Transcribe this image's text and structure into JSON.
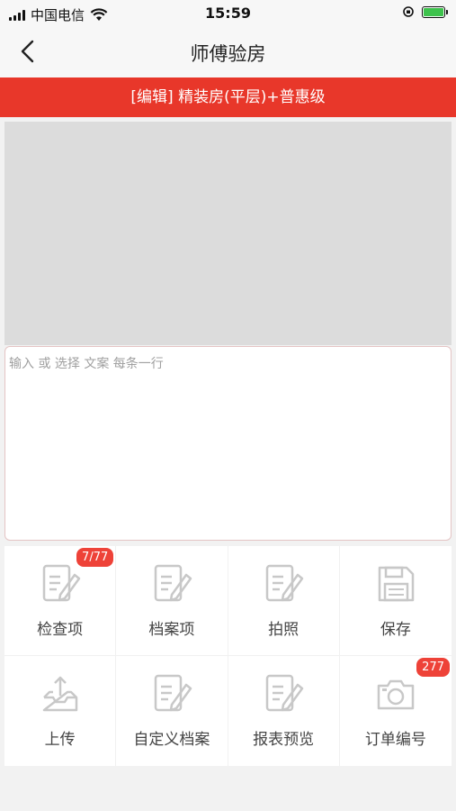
{
  "status_bar": {
    "carrier": "中国电信",
    "time": "15:59"
  },
  "nav": {
    "title": "师傅验房"
  },
  "banner": {
    "text": "[编辑] 精装房(平层)+普惠级"
  },
  "editor": {
    "placeholder": "输入 或 选择 文案 每条一行"
  },
  "actions": [
    {
      "label": "检查项",
      "icon": "document-edit-icon",
      "badge": "7/77"
    },
    {
      "label": "档案项",
      "icon": "document-edit-icon",
      "badge": ""
    },
    {
      "label": "拍照",
      "icon": "document-edit-icon",
      "badge": ""
    },
    {
      "label": "保存",
      "icon": "floppy-disk-icon",
      "badge": ""
    },
    {
      "label": "上传",
      "icon": "upload-tray-icon",
      "badge": ""
    },
    {
      "label": "自定义档案",
      "icon": "document-edit-icon",
      "badge": ""
    },
    {
      "label": "报表预览",
      "icon": "document-edit-icon",
      "badge": ""
    },
    {
      "label": "订单编号",
      "icon": "camera-icon",
      "badge": "277"
    }
  ],
  "colors": {
    "accent": "#e8372a",
    "badge": "#ee4238",
    "icon": "#c8c8c8"
  }
}
